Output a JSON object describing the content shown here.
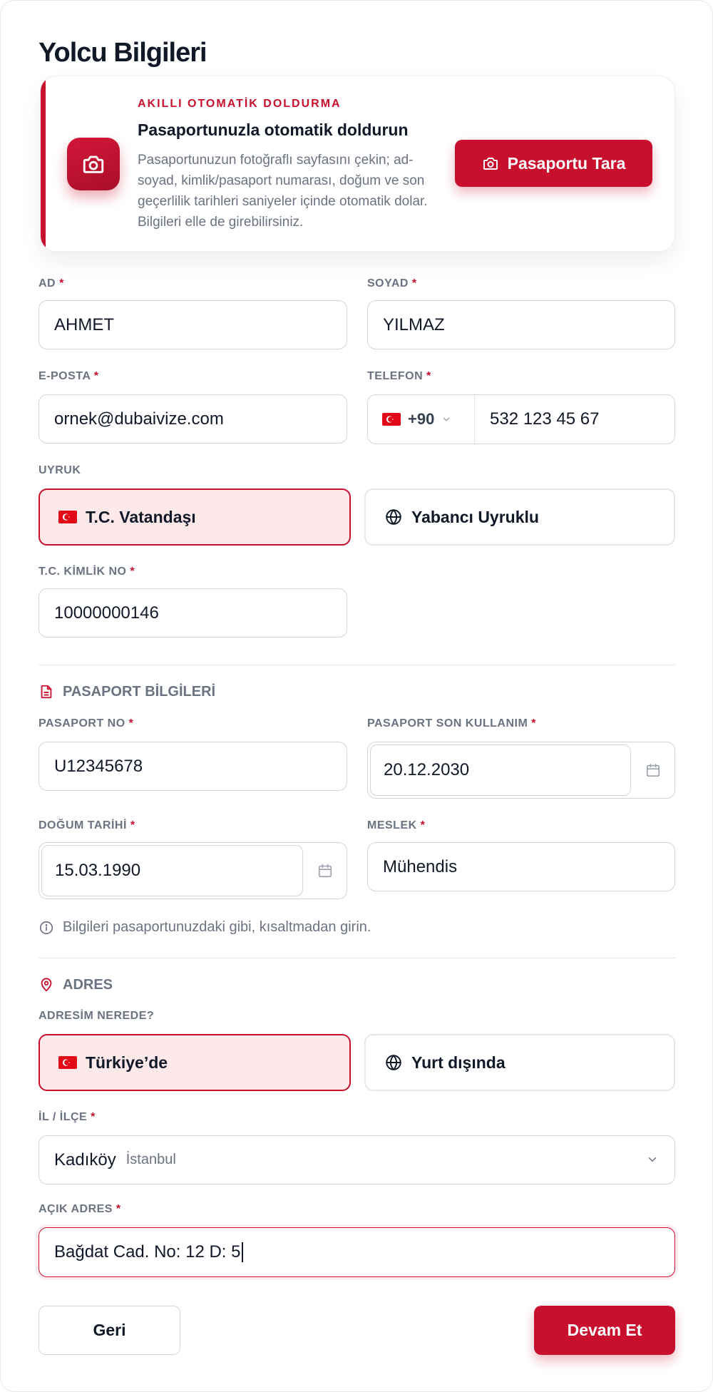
{
  "page": {
    "title": "Yolcu Bilgileri"
  },
  "banner": {
    "kicker": "AKILLI OTOMATİK DOLDURMA",
    "heading": "Pasaportunuzla otomatik doldurun",
    "description": "Pasaportunuzun fotoğraflı sayfasını çekin; ad-soyad, kimlik/pasaport numarası, doğum ve son geçerlilik tarihleri saniyeler içinde otomatik dolar. Bilgileri elle de girebilirsiniz.",
    "button_label": "Pasaportu Tara"
  },
  "fields": {
    "first_name": {
      "label": "AD",
      "value": "AHMET"
    },
    "last_name": {
      "label": "SOYAD",
      "value": "YILMAZ"
    },
    "email": {
      "label": "E-POSTA",
      "value": "ornek@dubaivize.com"
    },
    "phone": {
      "label": "TELEFON",
      "country_code": "+90",
      "value": "532 123 45 67"
    },
    "nationality": {
      "label": "UYRUK",
      "option_citizen": "T.C. Vatandaşı",
      "option_foreign": "Yabancı Uyruklu",
      "selected": "T.C. Vatandaşı"
    },
    "tc_id": {
      "label": "T.C. KİMLİK NO",
      "value": "10000000146"
    }
  },
  "passport": {
    "section_title": "PASAPORT BİLGİLERİ",
    "number": {
      "label": "PASAPORT NO",
      "value": "U12345678"
    },
    "expiry": {
      "label": "PASAPORT SON KULLANIM",
      "value": "20.12.2030"
    },
    "birth_date": {
      "label": "DOĞUM TARİHİ",
      "value": "15.03.1990"
    },
    "occupation": {
      "label": "MESLEK",
      "value": "Mühendis"
    },
    "hint": "Bilgileri pasaportunuzdaki gibi, kısaltmadan girin."
  },
  "address": {
    "section_title": "ADRES",
    "location": {
      "label": "ADRESİM NEREDE?",
      "option_turkey": "Türkiye’de",
      "option_abroad": "Yurt dışında",
      "selected": "Türkiye’de"
    },
    "city": {
      "label": "İL / İLÇE",
      "district": "Kadıköy",
      "province": "İstanbul"
    },
    "open_address": {
      "label": "AÇIK ADRES",
      "value": "Bağdat Cad. No: 12 D: 5"
    }
  },
  "actions": {
    "back_label": "Geri",
    "next_label": "Devam Et"
  },
  "required_marker": "*",
  "colors": {
    "accent": "#c8102e",
    "active_bg": "#fde8ea",
    "muted_text": "#6b7280",
    "border": "#d1d5db"
  }
}
